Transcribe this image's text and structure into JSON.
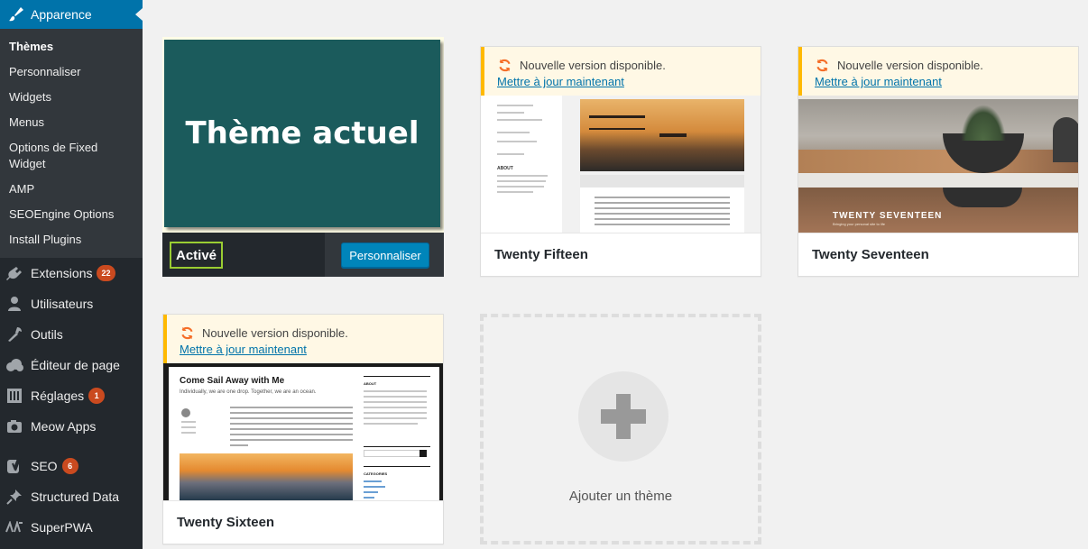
{
  "sidebar": {
    "current_menu": "Apparence",
    "submenu": [
      "Thèmes",
      "Personnaliser",
      "Widgets",
      "Menus",
      "Options de Fixed Widget",
      "AMP",
      "SEOEngine Options",
      "Install Plugins"
    ],
    "menus": [
      {
        "label": "Extensions",
        "icon": "plugin-icon",
        "badge": "22"
      },
      {
        "label": "Utilisateurs",
        "icon": "users-icon",
        "badge": ""
      },
      {
        "label": "Outils",
        "icon": "wrench-icon",
        "badge": ""
      },
      {
        "label": "Éditeur de page",
        "icon": "cloud-icon",
        "badge": ""
      },
      {
        "label": "Réglages",
        "icon": "settings-icon",
        "badge": "1"
      },
      {
        "label": "Meow Apps",
        "icon": "camera-icon",
        "badge": ""
      },
      {
        "label": "SEO",
        "icon": "yoast-icon",
        "badge": "6"
      },
      {
        "label": "Structured Data",
        "icon": "pin-icon",
        "badge": ""
      },
      {
        "label": "SuperPWA",
        "icon": "pwa-icon",
        "badge": ""
      }
    ]
  },
  "active_theme": {
    "poster_text": "Thème actuel",
    "status": "Activé",
    "customize": "Personnaliser"
  },
  "update_notice": {
    "text": "Nouvelle version disponible.",
    "link": "Mettre à jour maintenant"
  },
  "themes": [
    {
      "name": "Twenty Fifteen"
    },
    {
      "name": "Twenty Seventeen",
      "banner": "TWENTY SEVENTEEN",
      "tagline": "Bringing your personal site to life"
    },
    {
      "name": "Twenty Sixteen",
      "post_title": "Come Sail Away with Me",
      "post_sub": "Individually, we are one drop. Together, we are an ocean.",
      "about": "ABOUT",
      "categories": "CATEGORIES"
    }
  ],
  "fifteen_labels": {
    "about": "ABOUT"
  },
  "add_theme": "Ajouter un thème",
  "colors": {
    "wp_blue": "#0073aa",
    "sidebar": "#23282d",
    "notice": "#ffb900",
    "poster": "#1b5b5c",
    "badge": "#ca4a1f"
  }
}
